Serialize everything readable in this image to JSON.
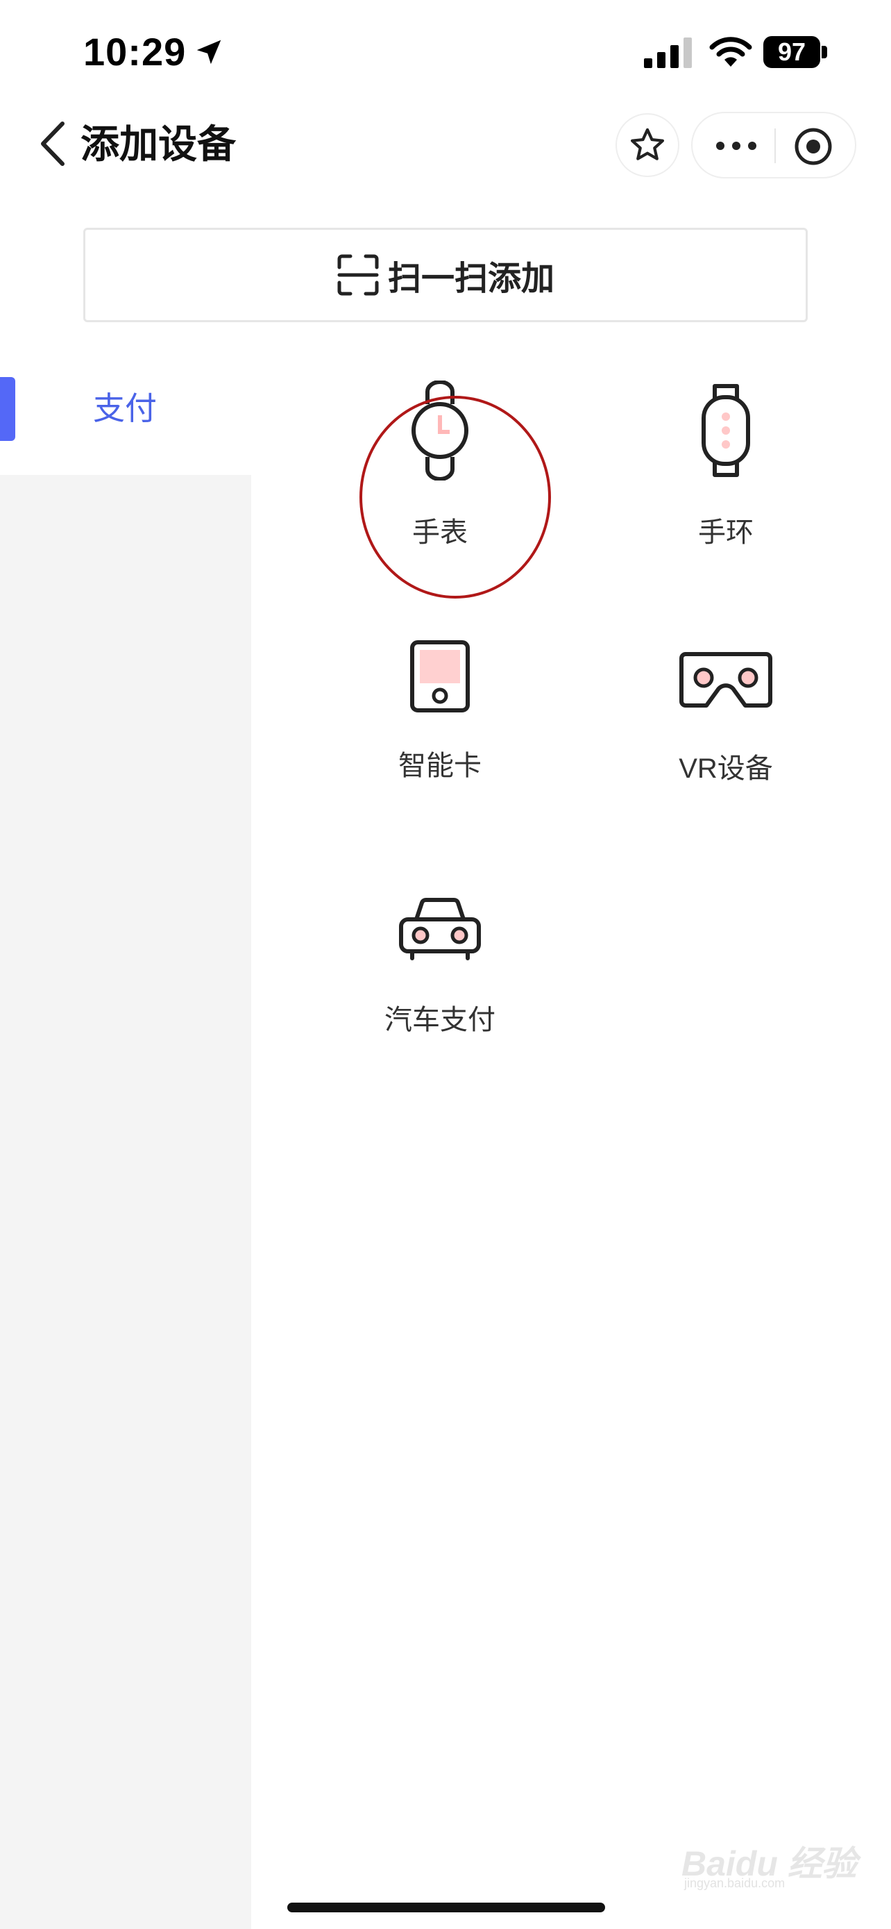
{
  "status_bar": {
    "time": "10:29",
    "battery": "97"
  },
  "header": {
    "title": "添加设备"
  },
  "scan": {
    "label": "扫一扫添加"
  },
  "sidebar": {
    "items": [
      {
        "label": "支付",
        "selected": true
      }
    ]
  },
  "devices": [
    {
      "label": "手表",
      "icon": "watch-icon"
    },
    {
      "label": "手环",
      "icon": "band-icon"
    },
    {
      "label": "智能卡",
      "icon": "smart-card-icon"
    },
    {
      "label": "VR设备",
      "icon": "vr-headset-icon"
    },
    {
      "label": "汽车支付",
      "icon": "car-icon"
    }
  ],
  "colors": {
    "accent": "#4a63e8",
    "icon_pink": "#ffd0d0",
    "annotation": "#b01818"
  },
  "watermark": {
    "text": "Baidu 经验",
    "sub": "jingyan.baidu.com"
  }
}
